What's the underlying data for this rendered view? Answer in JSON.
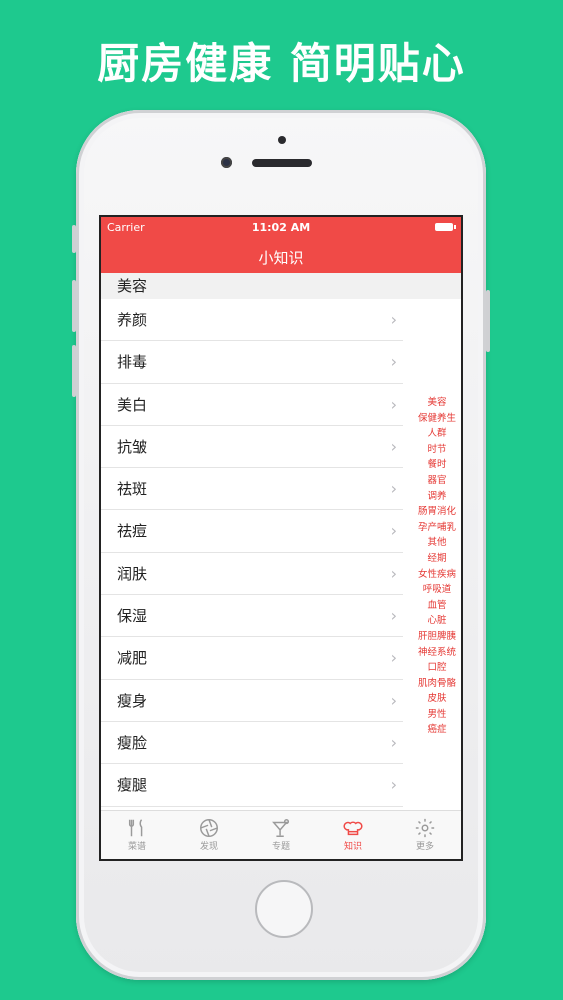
{
  "headline": "厨房健康 简明贴心",
  "status": {
    "carrier": "Carrier",
    "time": "11:02 AM"
  },
  "nav": {
    "title": "小知识"
  },
  "section": {
    "title": "美容"
  },
  "rows": [
    {
      "label": "养颜"
    },
    {
      "label": "排毒"
    },
    {
      "label": "美白"
    },
    {
      "label": "抗皱"
    },
    {
      "label": "祛斑"
    },
    {
      "label": "祛痘"
    },
    {
      "label": "润肤"
    },
    {
      "label": "保湿"
    },
    {
      "label": "减肥"
    },
    {
      "label": "瘦身"
    },
    {
      "label": "瘦脸"
    },
    {
      "label": "瘦腿"
    }
  ],
  "index": [
    "美容",
    "保健养生",
    "人群",
    "时节",
    "餐时",
    "器官",
    "调养",
    "肠胃消化",
    "孕产哺乳",
    "其他",
    "经期",
    "女性疾病",
    "呼吸道",
    "血管",
    "心脏",
    "肝胆脾胰",
    "神经系统",
    "口腔",
    "肌肉骨骼",
    "皮肤",
    "男性",
    "癌症"
  ],
  "tabs": [
    {
      "label": "菜谱",
      "icon": "fork-knife-icon"
    },
    {
      "label": "发现",
      "icon": "aperture-icon"
    },
    {
      "label": "专题",
      "icon": "cocktail-icon"
    },
    {
      "label": "知识",
      "icon": "chef-hat-icon",
      "active": true
    },
    {
      "label": "更多",
      "icon": "gear-icon"
    }
  ],
  "colors": {
    "background": "#1ec98e",
    "nav": "#f04a47",
    "accent": "#e53935"
  }
}
